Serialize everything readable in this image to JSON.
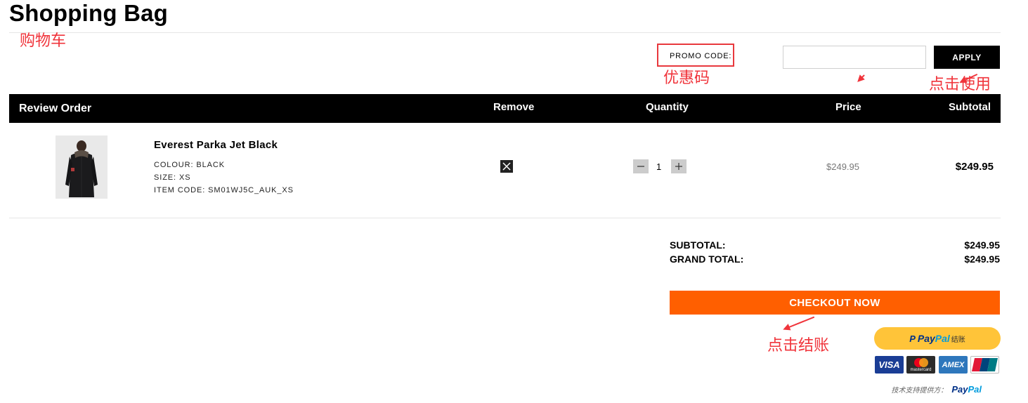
{
  "page": {
    "title": "Shopping Bag"
  },
  "annotations": {
    "cart": "购物车",
    "promo_code": "优惠码",
    "click_to_apply": "点击使用",
    "click_to_checkout": "点击结账"
  },
  "promo": {
    "label": "PROMO CODE:",
    "input_value": "",
    "apply_label": "APPLY"
  },
  "table": {
    "headers": {
      "review_order": "Review Order",
      "remove": "Remove",
      "quantity": "Quantity",
      "price": "Price",
      "subtotal": "Subtotal"
    }
  },
  "items": [
    {
      "name": "Everest Parka Jet Black",
      "colour_label": "COLOUR:",
      "colour_value": "BLACK",
      "size_label": "SIZE:",
      "size_value": "XS",
      "item_code_label": "ITEM CODE:",
      "item_code_value": "SM01WJ5C_AUK_XS",
      "quantity": "1",
      "price": "$249.95",
      "subtotal": "$249.95"
    }
  ],
  "summary": {
    "subtotal_label": "SUBTOTAL:",
    "subtotal_value": "$249.95",
    "grand_total_label": "GRAND TOTAL:",
    "grand_total_value": "$249.95"
  },
  "checkout": {
    "label": "CHECKOUT NOW"
  },
  "paypal": {
    "button_word_1": "Pay",
    "button_word_2": "Pal",
    "button_suffix": "结账",
    "cards": {
      "visa": "VISA",
      "mastercard": "mastercard",
      "amex": "AMEX",
      "unionpay_top": "UnionPay",
      "unionpay_bottom": "银联"
    },
    "powered_by_label": "技术支持提供方：",
    "powered_word_1": "Pay",
    "powered_word_2": "Pal"
  },
  "colors": {
    "accent_orange": "#ff5f00",
    "annotation_red": "#f0343b",
    "paypal_yellow": "#ffc439",
    "header_black": "#000000"
  },
  "icons": {
    "remove": "close-icon",
    "decrease": "minus-icon",
    "increase": "plus-icon",
    "paypal": "paypal-logo-icon"
  }
}
